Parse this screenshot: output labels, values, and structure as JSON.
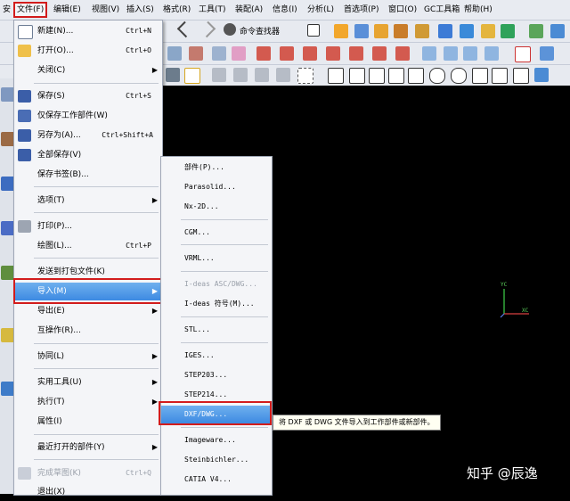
{
  "menubar": {
    "items": [
      "文件(F)",
      "编辑(E)",
      "视图(V)",
      "插入(S)",
      "格式(R)",
      "工具(T)",
      "装配(A)",
      "信息(I)",
      "分析(L)",
      "首选项(P)",
      "窗口(O)",
      "GC工具箱",
      "帮助(H)"
    ],
    "stub_left": "安"
  },
  "toolbar": {
    "command_finder": "命令查找器"
  },
  "file_menu": {
    "items": [
      {
        "label": "新建(N)...",
        "shortcut": "Ctrl+N",
        "icon": "new-file-icon"
      },
      {
        "label": "打开(O)...",
        "shortcut": "Ctrl+O",
        "icon": "open-folder-icon"
      },
      {
        "label": "关闭(C)",
        "submenu": true
      },
      {
        "label": "保存(S)",
        "shortcut": "Ctrl+S",
        "icon": "save-icon"
      },
      {
        "label": "仅保存工作部件(W)",
        "icon": "save-work-part-icon"
      },
      {
        "label": "另存为(A)...",
        "shortcut": "Ctrl+Shift+A",
        "icon": "save-as-icon"
      },
      {
        "label": "全部保存(V)",
        "icon": "save-all-icon"
      },
      {
        "label": "保存书签(B)..."
      },
      {
        "label": "选项(T)",
        "submenu": true
      },
      {
        "label": "打印(P)...",
        "icon": "print-icon"
      },
      {
        "label": "绘图(L)...",
        "shortcut": "Ctrl+P"
      },
      {
        "label": "发送到打包文件(K)"
      },
      {
        "label": "导入(M)",
        "submenu": true,
        "highlighted": true
      },
      {
        "label": "导出(E)",
        "submenu": true
      },
      {
        "label": "互操作(R)..."
      },
      {
        "label": "协同(L)",
        "submenu": true
      },
      {
        "label": "实用工具(U)",
        "submenu": true
      },
      {
        "label": "执行(T)",
        "submenu": true
      },
      {
        "label": "属性(I)"
      },
      {
        "label": "最近打开的部件(Y)",
        "submenu": true
      },
      {
        "label": "完成草图(K)",
        "shortcut": "Ctrl+Q",
        "disabled": true,
        "icon": "finish-sketch-icon"
      },
      {
        "label": "退出(X)"
      }
    ]
  },
  "import_menu": {
    "items": [
      {
        "label": "部件(P)..."
      },
      {
        "label": "Parasolid..."
      },
      {
        "label": "Nx-2D..."
      },
      {
        "label": "CGM..."
      },
      {
        "label": "VRML..."
      },
      {
        "label": "I-deas ASC/DWG...",
        "disabled": true
      },
      {
        "label": "I-deas 符号(M)..."
      },
      {
        "label": "STL..."
      },
      {
        "label": "IGES..."
      },
      {
        "label": "STEP203..."
      },
      {
        "label": "STEP214..."
      },
      {
        "label": "DXF/DWG...",
        "highlighted": true
      },
      {
        "label": "Imageware..."
      },
      {
        "label": "Steinbichler..."
      },
      {
        "label": "CATIA V4..."
      }
    ]
  },
  "tooltip": "将 DXF 或 DWG 文件导入到工作部件或新部件。",
  "axes": {
    "x": "XC",
    "y": "YC"
  },
  "watermark": "知乎 @辰逸",
  "colors": {
    "highlight": "#3d8ae2",
    "red_box": "#d21c1c",
    "canvas": "#000000"
  }
}
